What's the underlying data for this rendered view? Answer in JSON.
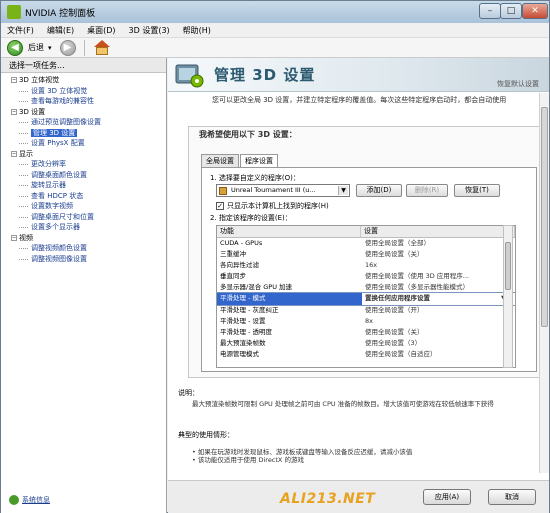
{
  "window": {
    "title": "NVIDIA 控制面板",
    "min": "–",
    "max": "□",
    "close": "✕"
  },
  "menu": [
    "文件(F)",
    "编辑(E)",
    "桌面(D)",
    "3D 设置(3)",
    "帮助(H)"
  ],
  "toolbar": {
    "back_label": "后退",
    "dropdown": "▾",
    "back_icon": "◀",
    "forward_icon": "▶"
  },
  "sidebar": {
    "header": "选择一项任务...",
    "tree": [
      {
        "type": "cat",
        "label": "3D 立体视觉"
      },
      {
        "type": "leaf",
        "label": "设置 3D 立体视觉"
      },
      {
        "type": "leaf",
        "label": "查看每游戏的兼容性"
      },
      {
        "type": "cat",
        "label": "3D 设置"
      },
      {
        "type": "leaf",
        "label": "通过预览调整图像设置"
      },
      {
        "type": "leaf",
        "label": "管理 3D 设置",
        "selected": true
      },
      {
        "type": "leaf",
        "label": "设置 PhysX 配置"
      },
      {
        "type": "cat",
        "label": "显示"
      },
      {
        "type": "leaf",
        "label": "更改分辨率"
      },
      {
        "type": "leaf",
        "label": "调整桌面颜色设置"
      },
      {
        "type": "leaf",
        "label": "旋转显示器"
      },
      {
        "type": "leaf",
        "label": "查看 HDCP 状态"
      },
      {
        "type": "leaf",
        "label": "设置数字视频"
      },
      {
        "type": "leaf",
        "label": "调整桌面尺寸和位置"
      },
      {
        "type": "leaf",
        "label": "设置多个显示器"
      },
      {
        "type": "cat",
        "label": "视频"
      },
      {
        "type": "leaf",
        "label": "调整视频颜色设置"
      },
      {
        "type": "leaf",
        "label": "调整视频图像设置"
      }
    ],
    "system_info": "系统信息"
  },
  "main": {
    "page_title": "管理 3D 设置",
    "restore_defaults": "恢复默认设置",
    "intro": "您可以更改全局 3D 设置，并建立特定程序的覆盖值。每次这些特定程序启动时，都会自动使用",
    "panel_heading": "我希望使用以下 3D 设置：",
    "tabs": [
      "全局设置",
      "程序设置"
    ],
    "step1": "1. 选择要自定义的程序(O)：",
    "program": "Unreal Tournament III (u...",
    "add_button": "添加(D)",
    "remove_button": "删除(R)",
    "restore_button": "恢复(T)",
    "only_show_checkbox": "只显示本计算机上找到的程序(H)",
    "step2": "2. 指定该程序的设置(E)：",
    "grid_headers": [
      "功能",
      "设置"
    ],
    "grid_rows": [
      [
        "CUDA - GPUs",
        "使用全局设置（全部）"
      ],
      [
        "三重缓冲",
        "使用全局设置（关）"
      ],
      [
        "各向异性过滤",
        "16x"
      ],
      [
        "垂直同步",
        "使用全局设置（使用 3D 应用程序..."
      ],
      [
        "多显示器/混合 GPU 加速",
        "使用全局设置（多显示器性能模式）"
      ],
      [
        "平滑处理 - 模式",
        "置换任何应用程序设置"
      ],
      [
        "平滑处理 - 灰度纠正",
        "使用全局设置（开）"
      ],
      [
        "平滑处理 - 设置",
        "8x"
      ],
      [
        "平滑处理 - 透明度",
        "使用全局设置（关）"
      ],
      [
        "最大预渲染帧数",
        "使用全局设置（3）"
      ],
      [
        "电源管理模式",
        "使用全局设置（自适应）"
      ]
    ],
    "selected_row": 5,
    "description_title": "说明：",
    "description_text": "最大预渲染帧数可限制 GPU 处理帧之前可由 CPU 准备的帧数目。增大该值可使游戏在较低帧速率下获得",
    "usage_title": "典型的使用情形：",
    "usage_list": [
      "如果在玩游戏时发现鼠标、游戏板或键盘等输入设备反应迟缓，请减小该值",
      "该功能仅适用于使用 DirectX 的游戏"
    ]
  },
  "footer": {
    "apply": "应用(A)",
    "cancel": "取消"
  },
  "watermark": "ALI213.NET",
  "colors": {
    "accent": "#3366cc",
    "nvidia_green": "#76b900",
    "banner_text": "#2c5a70"
  }
}
